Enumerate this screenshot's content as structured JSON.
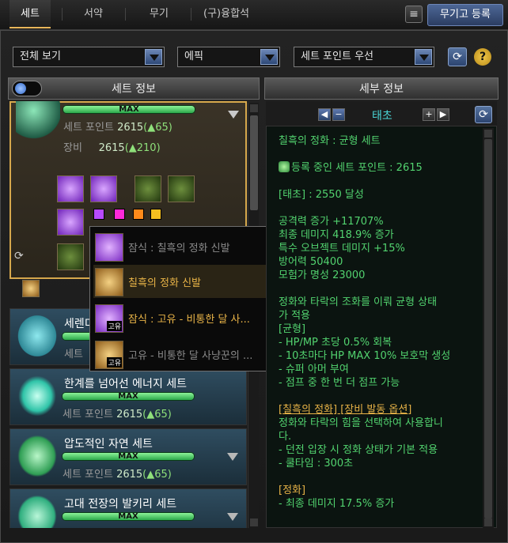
{
  "tabs": [
    "세트",
    "서약",
    "무기",
    "(구)융합석"
  ],
  "register_button": "무기고 등록",
  "filters": {
    "view": "전체 보기",
    "rarity": "에픽",
    "sort": "세트 포인트 우선"
  },
  "help_icon": "?",
  "left_header": "세트 정보",
  "right_header": "세부 정보",
  "selected_set": {
    "bar_label": "MAX",
    "points_label": "세트 포인트",
    "points_value": "2615",
    "points_delta": "(▲65)",
    "equip_label": "장비",
    "equip_value": "2615",
    "equip_delta": "(▲210)"
  },
  "swatch_colors": [
    "#b84bff",
    "#ff2ad9",
    "#ff8a1a",
    "#f5c020"
  ],
  "popup_items": [
    {
      "label": "잠식 : 칠흑의 정화 신발",
      "color": "#8a8a8a"
    },
    {
      "label": "칠흑의 정화 신발",
      "color": "#e8b347"
    },
    {
      "label": "잠식 : 고유 - 비통한 달 사...",
      "color": "#e8b347"
    },
    {
      "label": "고유 - 비통한 달 사냥꾼의 ...",
      "color": "#8a8a8a"
    }
  ],
  "badge_label": "고유",
  "sets": [
    {
      "name": "세렌디",
      "points_label": "세트"
    },
    {
      "name": "한계를 넘어선 에너지 세트",
      "bar": "MAX",
      "points_label": "세트 포인트",
      "points_value": "2615",
      "points_delta": "(▲65)"
    },
    {
      "name": "압도적인 자연 세트",
      "bar": "MAX",
      "points_label": "세트 포인트",
      "points_value": "2615",
      "points_delta": "(▲65)"
    },
    {
      "name": "고대 전장의 발키리 세트",
      "bar": "MAX"
    }
  ],
  "detail": {
    "tier": "태초",
    "lines": [
      {
        "text": "칠흑의 정화 : 균형 세트",
        "cls": ""
      },
      {
        "text": "",
        "cls": ""
      },
      {
        "text": "등록 중인 세트 포인트 : 2615",
        "cls": "",
        "icon": true
      },
      {
        "text": "",
        "cls": ""
      },
      {
        "text": "[태초] : 2550 달성",
        "cls": ""
      },
      {
        "text": "",
        "cls": ""
      },
      {
        "text": "공격력 증가 +11707%",
        "cls": ""
      },
      {
        "text": "최종 데미지 418.9% 증가",
        "cls": ""
      },
      {
        "text": "특수 오브젝트 데미지 +15%",
        "cls": ""
      },
      {
        "text": "방어력 50400",
        "cls": ""
      },
      {
        "text": "모험가 명성 23000",
        "cls": ""
      },
      {
        "text": "",
        "cls": ""
      },
      {
        "text": "정화와 타락의 조화를 이뤄 균형 상태",
        "cls": ""
      },
      {
        "text": "가 적용",
        "cls": ""
      },
      {
        "text": "[균형]",
        "cls": ""
      },
      {
        "text": "- HP/MP 초당 0.5% 회복",
        "cls": ""
      },
      {
        "text": "- 10초마다 HP MAX 10% 보호막 생성",
        "cls": ""
      },
      {
        "text": "- 슈퍼 아머 부여",
        "cls": ""
      },
      {
        "text": "- 점프 중 한 번 더 점프 가능",
        "cls": ""
      },
      {
        "text": "",
        "cls": ""
      },
      {
        "text": "[칠흑의 정화] [장비 발동 옵션]",
        "cls": "gold uline"
      },
      {
        "text": "정화와 타락의 힘을 선택하여 사용합니",
        "cls": ""
      },
      {
        "text": "다.",
        "cls": ""
      },
      {
        "text": "- 던전 입장 시 정화 상태가 기본 적용",
        "cls": ""
      },
      {
        "text": "- 쿨타임 : 300초",
        "cls": ""
      },
      {
        "text": "",
        "cls": ""
      },
      {
        "text": "[정화]",
        "cls": "gold"
      },
      {
        "text": "- 최종 데미지 17.5% 증가",
        "cls": ""
      }
    ]
  }
}
